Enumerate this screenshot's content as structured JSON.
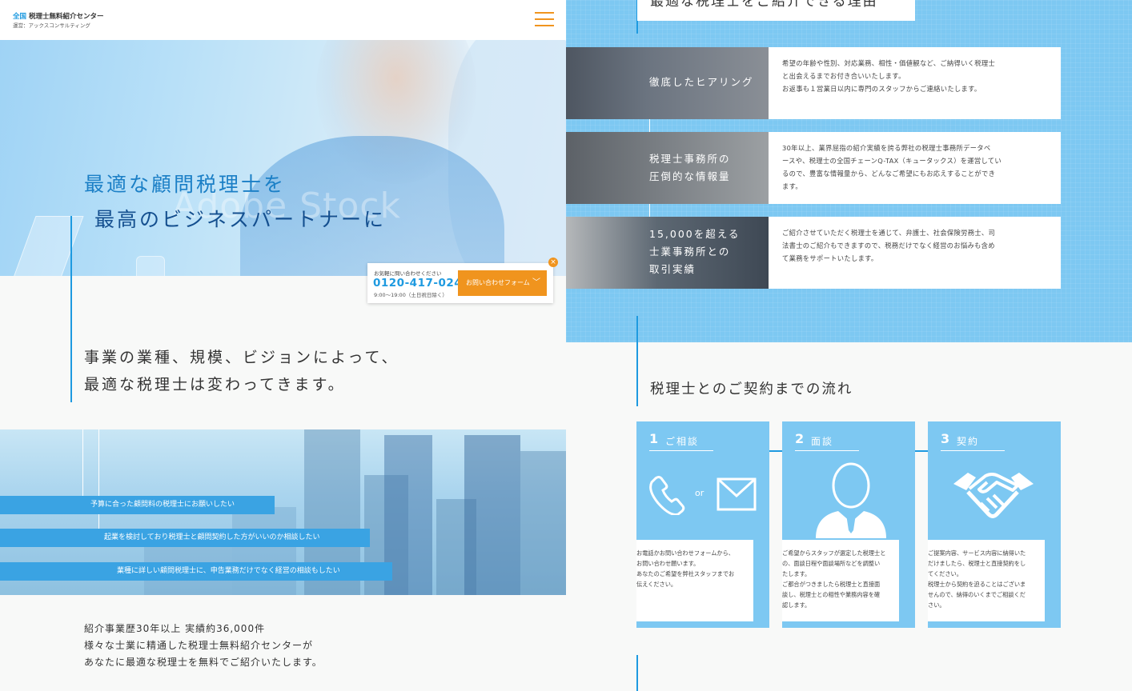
{
  "header": {
    "logo_accent": "全国",
    "logo_name": "税理士無料紹介センター",
    "logo_sub": "運営：アックスコンサルティング",
    "menu_icon": "hamburger-icon"
  },
  "hero": {
    "title_line1": "最適な顧問税理士を",
    "title_line2": "最高のビジネスパートナーに",
    "watermark": "Adobe Stock",
    "player_controls": "◀◀ ▶ ▶▶"
  },
  "lead": {
    "line1": "事業の業種、規模、ビジョンによって、",
    "line2": "最適な税理士は変わってきます。"
  },
  "cta": {
    "label": "お気軽に問い合わせください",
    "tel": "0120-417-024",
    "hours": "9:00〜19:00（土日祝日除く）",
    "button": "お問い合わせフォーム",
    "close": "×"
  },
  "needs": [
    "予算に合った顧問料の税理士にお願いしたい",
    "起業を検討しており税理士と顧問契約した方がいいのか相談したい",
    "業種に詳しい顧問税理士に、申告業務だけでなく経営の相談もしたい"
  ],
  "intro": {
    "line1": "紹介事業歴30年以上 実績約36,000件",
    "line2": "様々な士業に精通した税理士無料紹介センターが",
    "line3": "あなたに最適な税理士を無料でご紹介いたします。"
  },
  "reasons": {
    "title": "最適な税理士をご紹介できる理由",
    "items": [
      {
        "label_lines": [
          "徹底したヒアリング"
        ],
        "text_lines": [
          "希望の年齢や性別、対応業務、相性・価値観など、ご納得いく税理士",
          "と出会えるまでお付き合いいたします。",
          "お返事も１営業日以内に専門のスタッフからご連絡いたします。"
        ]
      },
      {
        "label_lines": [
          "税理士事務所の",
          "圧倒的な情報量"
        ],
        "text_lines": [
          "30年以上、業界屈指の紹介実績を誇る弊社の税理士事務所データベ",
          "ースや、税理士の全国チェーンQ-TAX（キュータックス）を運営してい",
          "るので、豊富な情報量から、どんなご希望にもお応えすることができ",
          "ます。"
        ]
      },
      {
        "label_lines": [
          "15,000を超える",
          "士業事務所との",
          "取引実績"
        ],
        "text_lines": [
          "ご紹介させていただく税理士を通じて、弁護士、社会保険労務士、司",
          "法書士のご紹介もできますので、税務だけでなく経営のお悩みも含め",
          "て業務をサポートいたします。"
        ]
      }
    ]
  },
  "flow": {
    "title": "税理士とのご契約までの流れ",
    "steps": [
      {
        "num": "1",
        "label": "ご相談",
        "icon": "phone-or-mail-icon",
        "or_text": "or",
        "text_lines": [
          "お電話かお問い合わせフォームから、",
          "お問い合わせ願います。",
          "あなたのご希望を弊社スタッフまでお",
          "伝えください。"
        ]
      },
      {
        "num": "2",
        "label": "面談",
        "icon": "person-icon",
        "text_lines": [
          "ご希望からスタッフが選定した税理士と",
          "の、面談日程や面談場所などを調整い",
          "たします。",
          "ご都合がつきましたら税理士と直接面",
          "談し、税理士との相性や業務内容を確",
          "認します。"
        ]
      },
      {
        "num": "3",
        "label": "契約",
        "icon": "handshake-icon",
        "text_lines": [
          "ご提案内容、サービス内容に納得いた",
          "だけましたら、税理士と直接契約をし",
          "てください。",
          "税理士から契約を迫ることはございま",
          "せんので、納得のいくまでご相談くだ",
          "さい。"
        ]
      }
    ]
  },
  "colors": {
    "accent_blue": "#1e9ae0",
    "panel_blue": "#7dc8f2",
    "orange": "#f0941e"
  }
}
